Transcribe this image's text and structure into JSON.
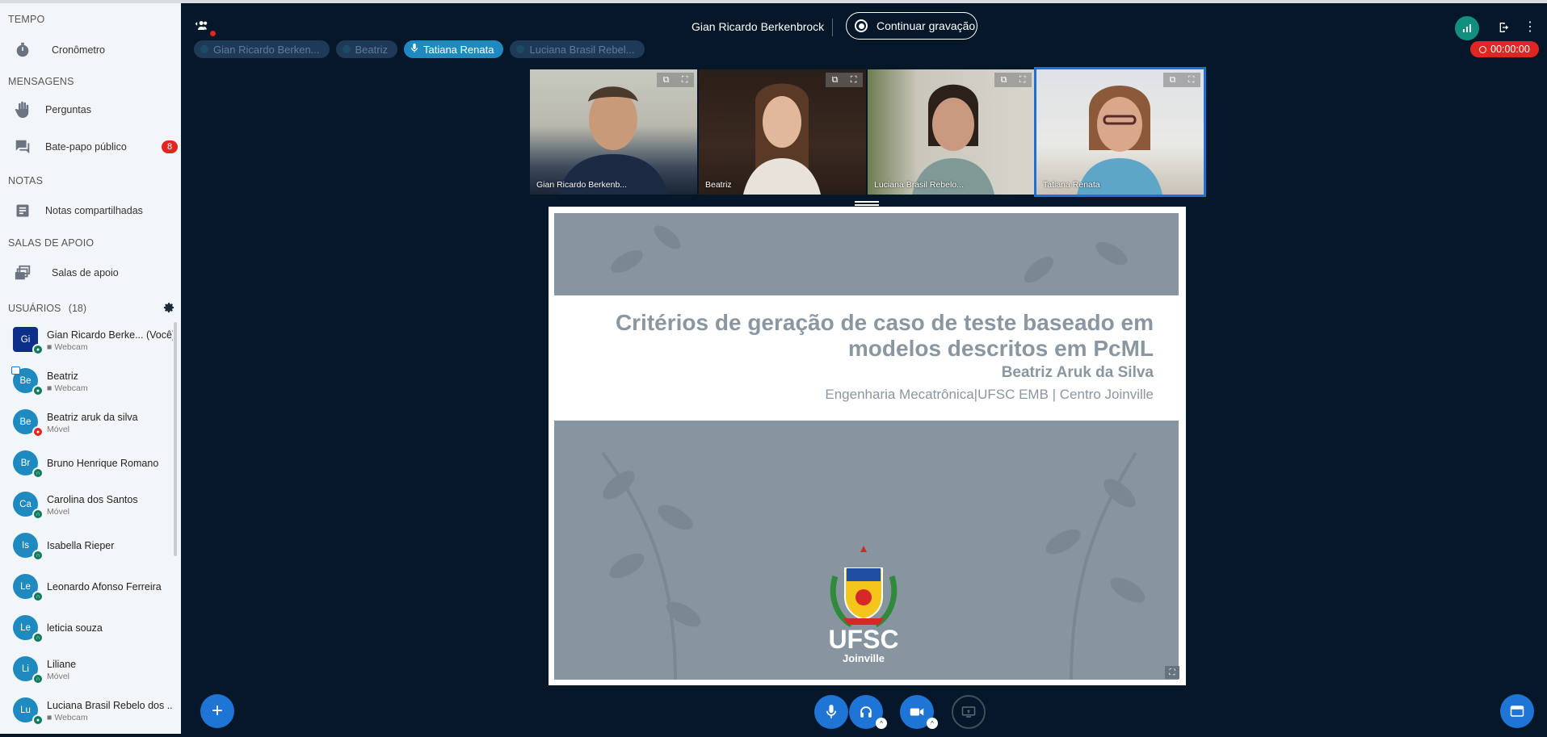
{
  "sidebar": {
    "sections": {
      "tempo": "TEMPO",
      "mensagens": "MENSAGENS",
      "notas": "NOTAS",
      "salas": "SALAS DE APOIO"
    },
    "items": {
      "cronometro": "Cronômetro",
      "perguntas": "Perguntas",
      "chat": "Bate-papo público",
      "chat_badge": "8",
      "notas": "Notas compartilhadas",
      "salas": "Salas de apoio"
    },
    "users_title": "USUÁRIOS",
    "users_count": "(18)",
    "users": [
      {
        "initials": "Gi",
        "name": "Gian Ricardo Berke... (Você)",
        "sub": "Webcam"
      },
      {
        "initials": "Be",
        "name": "Beatriz",
        "sub": "Webcam"
      },
      {
        "initials": "Be",
        "name": "Beatriz aruk da silva",
        "sub": "Móvel"
      },
      {
        "initials": "Br",
        "name": "Bruno Henrique Romano",
        "sub": ""
      },
      {
        "initials": "Ca",
        "name": "Carolina dos Santos",
        "sub": "Móvel"
      },
      {
        "initials": "Is",
        "name": "Isabella Rieper",
        "sub": ""
      },
      {
        "initials": "Le",
        "name": "Leonardo Afonso Ferreira",
        "sub": ""
      },
      {
        "initials": "Le",
        "name": "leticia souza",
        "sub": ""
      },
      {
        "initials": "Li",
        "name": "Liliane",
        "sub": "Móvel"
      },
      {
        "initials": "Lu",
        "name": "Luciana Brasil Rebelo dos ...",
        "sub": "Webcam"
      }
    ]
  },
  "header": {
    "meeting_name": "Gian Ricardo Berkenbrock",
    "record_label": "Continuar gravação",
    "timer": "00:00:00",
    "talkers": [
      "Gian Ricardo Berken...",
      "Beatriz",
      "Tatiana Renata",
      "Luciana Brasil Rebel..."
    ]
  },
  "videos": [
    {
      "label": "Gian Ricardo Berkenb..."
    },
    {
      "label": "Beatriz"
    },
    {
      "label": "Luciana Brasil Rebelo..."
    },
    {
      "label": "Tatiana Renata"
    }
  ],
  "slide": {
    "title_line1": "Critérios de geração de caso de teste baseado em",
    "title_line2": "modelos descritos em PcML",
    "author": "Beatriz Aruk da Silva",
    "institution": "Engenharia Mecatrônica|UFSC EMB | Centro Joinville",
    "logo_text": "UFSC",
    "logo_sub": "Joinville"
  },
  "colors": {
    "accent": "#1f75d6",
    "alert": "#df2721",
    "background": "#06172a"
  }
}
